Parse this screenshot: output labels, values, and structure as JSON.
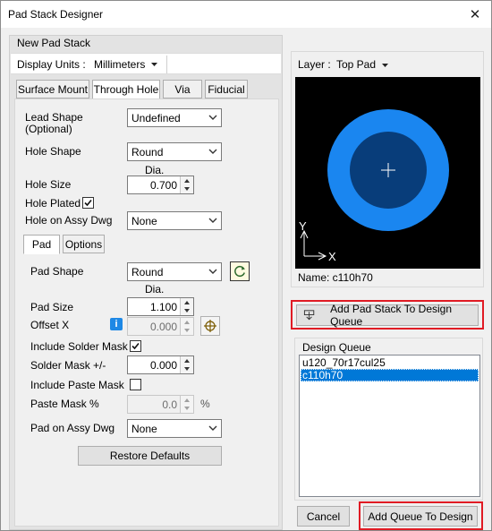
{
  "window": {
    "title": "Pad Stack Designer",
    "close_glyph": "✕"
  },
  "left_panel": {
    "group_title": "New Pad Stack",
    "display_units_label": "Display Units :",
    "display_units_value": "Millimeters",
    "tabs": [
      {
        "label": "Surface Mount",
        "active": false
      },
      {
        "label": "Through Hole",
        "active": true
      },
      {
        "label": "Via",
        "active": false
      },
      {
        "label": "Fiducial",
        "active": false
      }
    ],
    "lead_shape_label": "Lead Shape",
    "lead_shape_optional": "(Optional)",
    "lead_shape_value": "Undefined",
    "hole_shape_label": "Hole Shape",
    "hole_shape_value": "Round",
    "dia_header_1": "Dia.",
    "hole_size_label": "Hole Size",
    "hole_size_value": "0.700",
    "hole_plated_label": "Hole Plated",
    "hole_plated_checked": true,
    "hole_on_assy_label": "Hole on Assy Dwg",
    "hole_on_assy_value": "None",
    "subtabs": [
      {
        "label": "Pad",
        "active": true
      },
      {
        "label": "Options",
        "active": false
      }
    ],
    "pad_shape_label": "Pad Shape",
    "pad_shape_value": "Round",
    "dia_header_2": "Dia.",
    "pad_size_label": "Pad Size",
    "pad_size_value": "1.100",
    "offset_x_label": "Offset X",
    "offset_x_value": "0.000",
    "include_solder_mask_label": "Include Solder Mask",
    "include_solder_mask_checked": true,
    "solder_mask_label": "Solder Mask +/-",
    "solder_mask_value": "0.000",
    "include_paste_mask_label": "Include Paste Mask",
    "include_paste_mask_checked": false,
    "paste_mask_label": "Paste Mask %",
    "paste_mask_value": "0.0",
    "paste_mask_unit": "%",
    "pad_on_assy_label": "Pad on Assy Dwg",
    "pad_on_assy_value": "None",
    "restore_defaults_label": "Restore Defaults"
  },
  "right_panel": {
    "layer_label": "Layer :",
    "layer_value": "Top Pad",
    "axis_y": "Y",
    "axis_x": "X",
    "name_label": "Name: c110h70",
    "add_to_queue_label": "Add Pad Stack To Design Queue",
    "design_queue_title": "Design Queue",
    "queue_items": [
      {
        "label": "u120_70r17cul25",
        "selected": false
      },
      {
        "label": "c110h70",
        "selected": true
      }
    ],
    "cancel_label": "Cancel",
    "add_queue_label": "Add Queue To Design"
  },
  "colors": {
    "pad_outer": "#1a86f0",
    "pad_inner": "#083d7a",
    "highlight_red": "#e01b24",
    "selection": "#0078d7"
  },
  "icons": {
    "info": "info-icon",
    "crosshair": "crosshair-icon",
    "rotate": "rotate-icon",
    "add_to_queue": "download-arrow-icon"
  }
}
